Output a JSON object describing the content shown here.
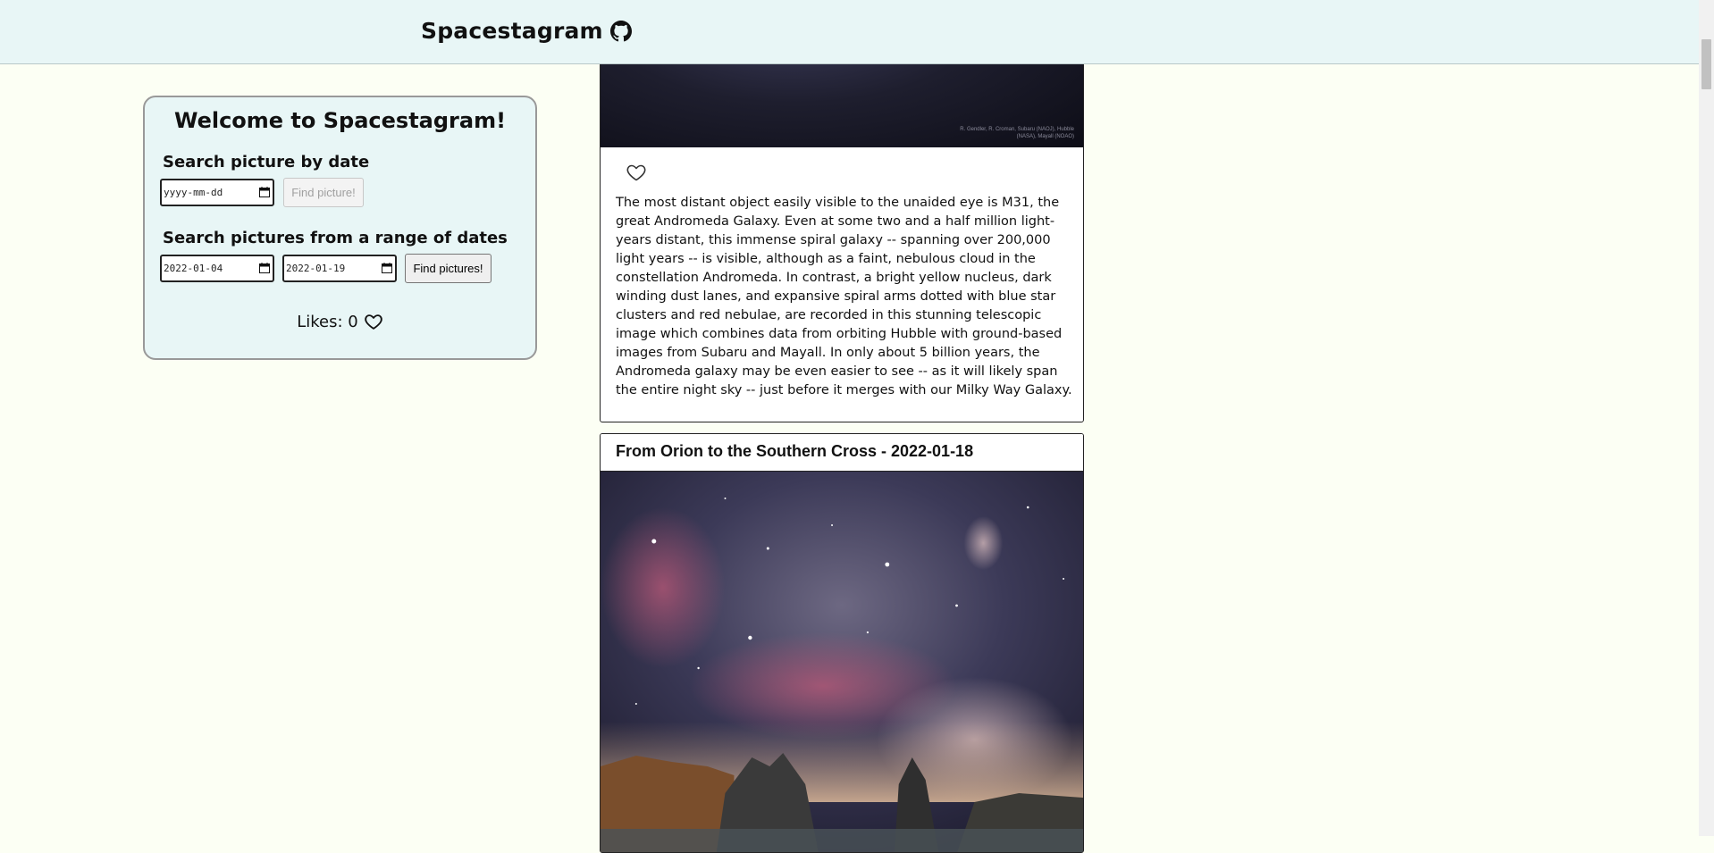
{
  "header": {
    "title": "Spacestagram",
    "github_icon": "github-icon"
  },
  "welcome": {
    "heading": "Welcome to Spacestagram!",
    "single_date": {
      "label": "Search picture by date",
      "value": "yyyy-mm-dd",
      "button": "Find picture!"
    },
    "range": {
      "label": "Search pictures from a range of dates",
      "start": "2022-01-04",
      "end": "2022-01-19",
      "button": "Find pictures!"
    },
    "likes_label": "Likes: 0",
    "likes_icon": "heart-icon"
  },
  "posts": [
    {
      "image_credit": "R. Gendler, R. Croman, Subaru (NAOJ), Hubble (NASA), Mayall (NOAO)",
      "like_icon": "heart-outline-icon",
      "explanation": "The most distant object easily visible to the unaided eye is M31, the great Andromeda Galaxy. Even at some two and a half million light-years distant, this immense spiral galaxy -- spanning over 200,000 light years -- is visible, although as a faint, nebulous cloud in the constellation Andromeda. In contrast, a bright yellow nucleus, dark winding dust lanes, and expansive spiral arms dotted with blue star clusters and red nebulae, are recorded in this stunning telescopic image which combines data from orbiting Hubble with ground-based images from Subaru and Mayall. In only about 5 billion years, the Andromeda galaxy may be even easier to see -- as it will likely span the entire night sky -- just before it merges with our Milky Way Galaxy."
    },
    {
      "title": "From Orion to the Southern Cross - 2022-01-18"
    }
  ]
}
